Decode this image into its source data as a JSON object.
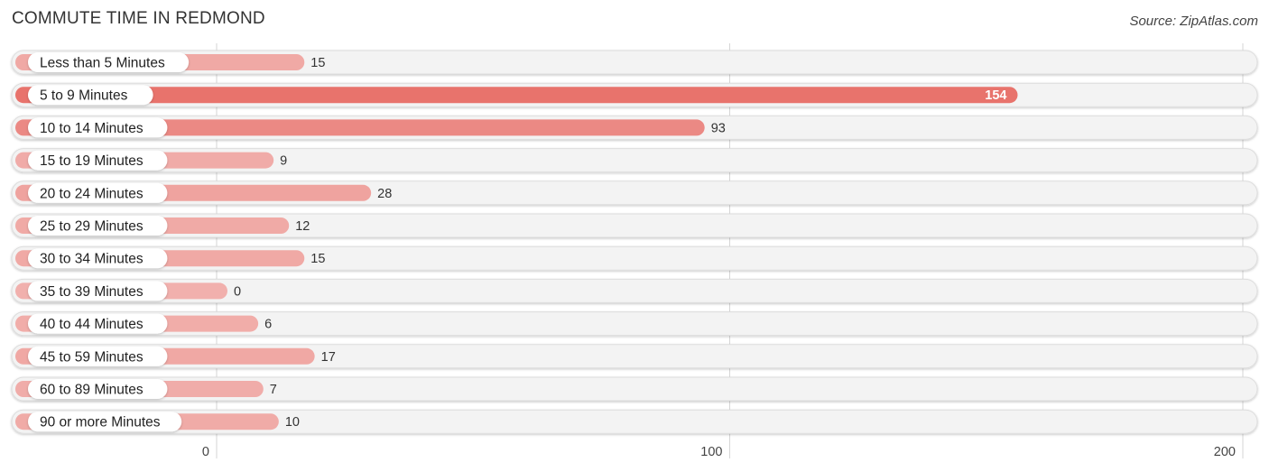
{
  "chart_data": {
    "type": "bar",
    "orientation": "horizontal",
    "title": "COMMUTE TIME IN REDMOND",
    "source": "Source: ZipAtlas.com",
    "categories": [
      "Less than 5 Minutes",
      "5 to 9 Minutes",
      "10 to 14 Minutes",
      "15 to 19 Minutes",
      "20 to 24 Minutes",
      "25 to 29 Minutes",
      "30 to 34 Minutes",
      "35 to 39 Minutes",
      "40 to 44 Minutes",
      "45 to 59 Minutes",
      "60 to 89 Minutes",
      "90 or more Minutes"
    ],
    "values": [
      15,
      154,
      93,
      9,
      28,
      12,
      15,
      0,
      6,
      17,
      7,
      10
    ],
    "xlim": [
      0,
      200
    ],
    "xticks": [
      0,
      100,
      200
    ],
    "xlabel": "",
    "ylabel": "",
    "grid": true,
    "colors": {
      "max": "#E8736C",
      "min": "#F1B0AD",
      "track": "#F3F3F3",
      "label_bg": "#FFFFFF"
    }
  }
}
